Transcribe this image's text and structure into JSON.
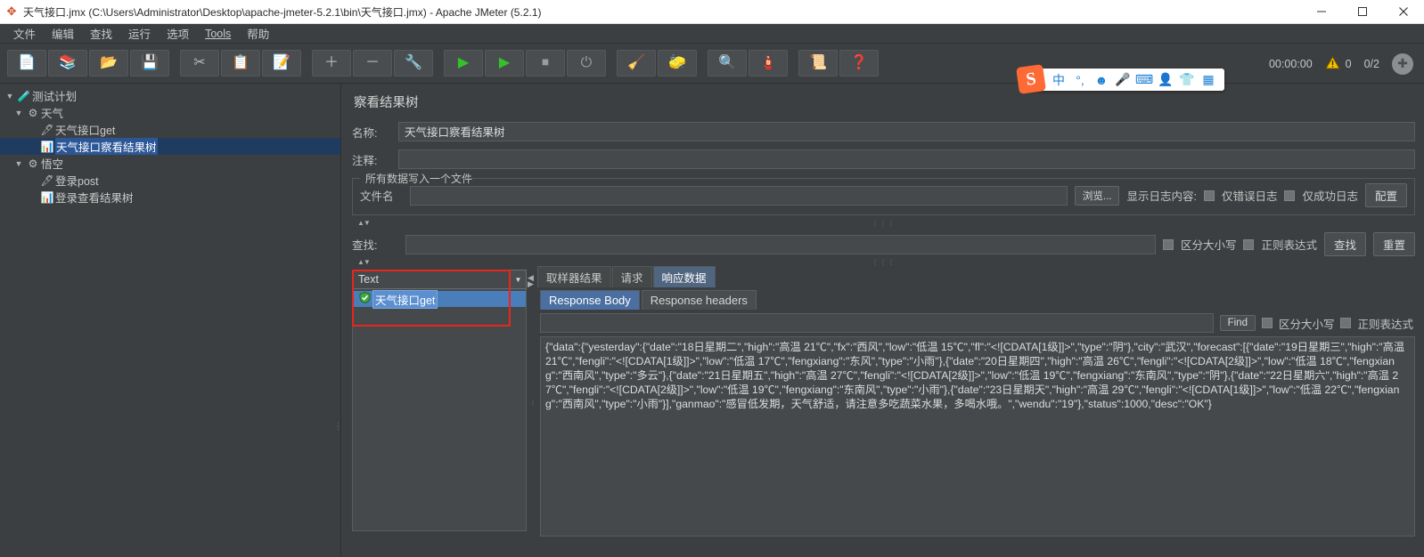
{
  "window": {
    "title": "天气接口.jmx (C:\\Users\\Administrator\\Desktop\\apache-jmeter-5.2.1\\bin\\天气接口.jmx) - Apache JMeter (5.2.1)",
    "app_icon": "jmeter-flask-icon",
    "minimize": "minimize-icon",
    "maximize": "maximize-icon",
    "close": "close-icon"
  },
  "menubar": {
    "items": [
      {
        "label": "文件",
        "name": "menu-file"
      },
      {
        "label": "编辑",
        "name": "menu-edit"
      },
      {
        "label": "查找",
        "name": "menu-search"
      },
      {
        "label": "运行",
        "name": "menu-run"
      },
      {
        "label": "选项",
        "name": "menu-options"
      },
      {
        "label": "Tools",
        "name": "menu-tools"
      },
      {
        "label": "帮助",
        "name": "menu-help"
      }
    ]
  },
  "toolbar": {
    "buttons": [
      {
        "name": "new-button",
        "icon": "📄"
      },
      {
        "name": "templates-button",
        "icon": "📚"
      },
      {
        "name": "open-button",
        "icon": "📂"
      },
      {
        "name": "save-button",
        "icon": "💾"
      },
      {
        "name": "cut-button",
        "icon": "✂"
      },
      {
        "name": "copy-button",
        "icon": "📋"
      },
      {
        "name": "paste-button",
        "icon": "📝"
      },
      {
        "name": "expand-all-button",
        "icon": "＋"
      },
      {
        "name": "collapse-all-button",
        "icon": "－"
      },
      {
        "name": "toggle-button",
        "icon": "🔧"
      },
      {
        "name": "start-button",
        "icon": "▶"
      },
      {
        "name": "start-no-pauses-button",
        "icon": "▶"
      },
      {
        "name": "stop-button",
        "icon": "⏹"
      },
      {
        "name": "shutdown-button",
        "icon": "⏻"
      },
      {
        "name": "clear-button",
        "icon": "🧹"
      },
      {
        "name": "clear-all-button",
        "icon": "🧽"
      },
      {
        "name": "search-button",
        "icon": "🔍"
      },
      {
        "name": "reset-search-button",
        "icon": "🧯"
      },
      {
        "name": "function-helper-button",
        "icon": "📜"
      },
      {
        "name": "help-button",
        "icon": "❓"
      }
    ],
    "elapsed_time": "00:00:00",
    "warning_icon": "warning-triangle-icon",
    "warning_count": "0",
    "threads_running": "0/2",
    "activity_icon": "activity-indicator-icon"
  },
  "ime": {
    "logo": "S",
    "items": [
      "中",
      "°,",
      "☻",
      "🎤",
      "⌨",
      "👤",
      "👕",
      "▦"
    ]
  },
  "tree": {
    "nodes": [
      {
        "label": "测试计划",
        "icon": "🧪",
        "indent": 0,
        "twisty": "▼",
        "selected": false,
        "name": "tree-node-test-plan"
      },
      {
        "label": "天气",
        "icon": "⚙",
        "indent": 1,
        "twisty": "▼",
        "selected": false,
        "name": "tree-node-thread-group-weather"
      },
      {
        "label": "天气接口get",
        "icon": "🖋",
        "indent": 2,
        "twisty": "",
        "selected": false,
        "name": "tree-node-http-sampler-weather-get"
      },
      {
        "label": "天气接口察看结果树",
        "icon": "📊",
        "indent": 2,
        "twisty": "",
        "selected": true,
        "name": "tree-node-view-results-tree-weather"
      },
      {
        "label": "悟空",
        "icon": "⚙",
        "indent": 1,
        "twisty": "▼",
        "selected": false,
        "name": "tree-node-thread-group-wukong"
      },
      {
        "label": "登录post",
        "icon": "🖋",
        "indent": 2,
        "twisty": "",
        "selected": false,
        "name": "tree-node-http-sampler-login-post"
      },
      {
        "label": "登录查看结果树",
        "icon": "📊",
        "indent": 2,
        "twisty": "",
        "selected": false,
        "name": "tree-node-view-results-tree-login"
      }
    ]
  },
  "panel": {
    "title": "察看结果树",
    "name_label": "名称:",
    "name_value": "天气接口察看结果树",
    "comment_label": "注释:",
    "comment_value": "",
    "filegroup": {
      "title": "所有数据写入一个文件",
      "filename_label": "文件名",
      "filename_value": "",
      "browse_button": "浏览...",
      "log_display_label": "显示日志内容:",
      "errors_only": "仅错误日志",
      "success_only": "仅成功日志",
      "configure_button": "配置"
    },
    "search": {
      "label": "查找:",
      "value": "",
      "case_sensitive": "区分大小写",
      "regex": "正则表达式",
      "find_button": "查找",
      "reset_button": "重置"
    },
    "renderer": {
      "selected": "Text",
      "dropdown_icon": "chevron-down-icon"
    },
    "results": [
      {
        "label": "天气接口get",
        "status_icon": "success-shield-icon",
        "selected": true
      }
    ],
    "tabs": [
      {
        "label": "取样器结果",
        "active": false,
        "name": "tab-sampler-result"
      },
      {
        "label": "请求",
        "active": false,
        "name": "tab-request"
      },
      {
        "label": "响应数据",
        "active": true,
        "name": "tab-response-data"
      }
    ],
    "subtabs": [
      {
        "label": "Response Body",
        "active": true,
        "name": "subtab-response-body"
      },
      {
        "label": "Response headers",
        "active": false,
        "name": "subtab-response-headers"
      }
    ],
    "findbar": {
      "value": "",
      "find_button": "Find",
      "case_sensitive": "区分大小写",
      "regex": "正则表达式"
    },
    "response_body": "{\"data\":{\"yesterday\":{\"date\":\"18日星期二\",\"high\":\"高温 21℃\",\"fx\":\"西风\",\"low\":\"低温 15℃\",\"fl\":\"<![CDATA[1级]]>\",\"type\":\"阴\"},\"city\":\"武汉\",\"forecast\":[{\"date\":\"19日星期三\",\"high\":\"高温 21℃\",\"fengli\":\"<![CDATA[1级]]>\",\"low\":\"低温 17℃\",\"fengxiang\":\"东风\",\"type\":\"小雨\"},{\"date\":\"20日星期四\",\"high\":\"高温 26℃\",\"fengli\":\"<![CDATA[2级]]>\",\"low\":\"低温 18℃\",\"fengxiang\":\"西南风\",\"type\":\"多云\"},{\"date\":\"21日星期五\",\"high\":\"高温 27℃\",\"fengli\":\"<![CDATA[2级]]>\",\"low\":\"低温 19℃\",\"fengxiang\":\"东南风\",\"type\":\"阴\"},{\"date\":\"22日星期六\",\"high\":\"高温 27℃\",\"fengli\":\"<![CDATA[2级]]>\",\"low\":\"低温 19℃\",\"fengxiang\":\"东南风\",\"type\":\"小雨\"},{\"date\":\"23日星期天\",\"high\":\"高温 29℃\",\"fengli\":\"<![CDATA[1级]]>\",\"low\":\"低温 22℃\",\"fengxiang\":\"西南风\",\"type\":\"小雨\"}],\"ganmao\":\"感冒低发期，天气舒适，请注意多吃蔬菜水果，多喝水哦。\",\"wendu\":\"19\"},\"status\":1000,\"desc\":\"OK\"}"
  },
  "colors": {
    "accent": "#2b5797",
    "selection": "#4a7ebb",
    "annotation": "#e8261c",
    "panel_bg": "#3c3f41",
    "field_bg": "#45494b"
  }
}
